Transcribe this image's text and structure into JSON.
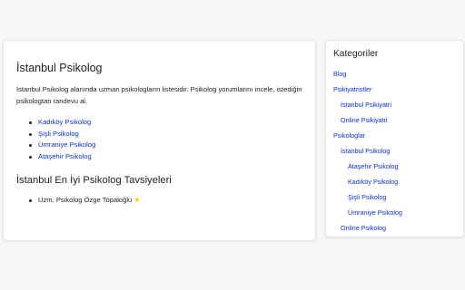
{
  "main": {
    "title": "İstanbul Psikolog",
    "intro": "İstanbul Psikolog alanında uzman psikologların listesidir. Psikolog yorumlarını incele, istediğin psikologtan randevu al.",
    "links": [
      {
        "label": "Kadıköy Psikolog"
      },
      {
        "label": "Şişli Psikolog"
      },
      {
        "label": "Ümraniye Psikolog"
      },
      {
        "label": "Ataşehir Psikolog"
      }
    ],
    "recommendations_title": "İstanbul En İyi Psikolog Tavsiyeleri",
    "recommendations": [
      {
        "label": "Uzm. Psikolog Özge Topaloğlu",
        "badge_icon": "star-icon",
        "badge_color": "#f5c400"
      }
    ]
  },
  "sidebar": {
    "title": "Kategoriler",
    "items": [
      {
        "label": "Blog"
      },
      {
        "label": "Psikiyatristler"
      },
      {
        "label": "İstanbul Psikiyatri"
      },
      {
        "label": "Online Psikiyatri"
      },
      {
        "label": "Psikologlar"
      },
      {
        "label": "İstanbul Psikolog"
      },
      {
        "label": "Ataşehir Psikolog"
      },
      {
        "label": "Kadıköy Psikolog"
      },
      {
        "label": "Şişli Psikolog"
      },
      {
        "label": "Ümraniye Psikolog"
      },
      {
        "label": "Online Psikolog"
      }
    ]
  },
  "colors": {
    "link": "#0b2fd6",
    "text": "#222222",
    "background": "#f6f7f9",
    "card": "#ffffff"
  }
}
